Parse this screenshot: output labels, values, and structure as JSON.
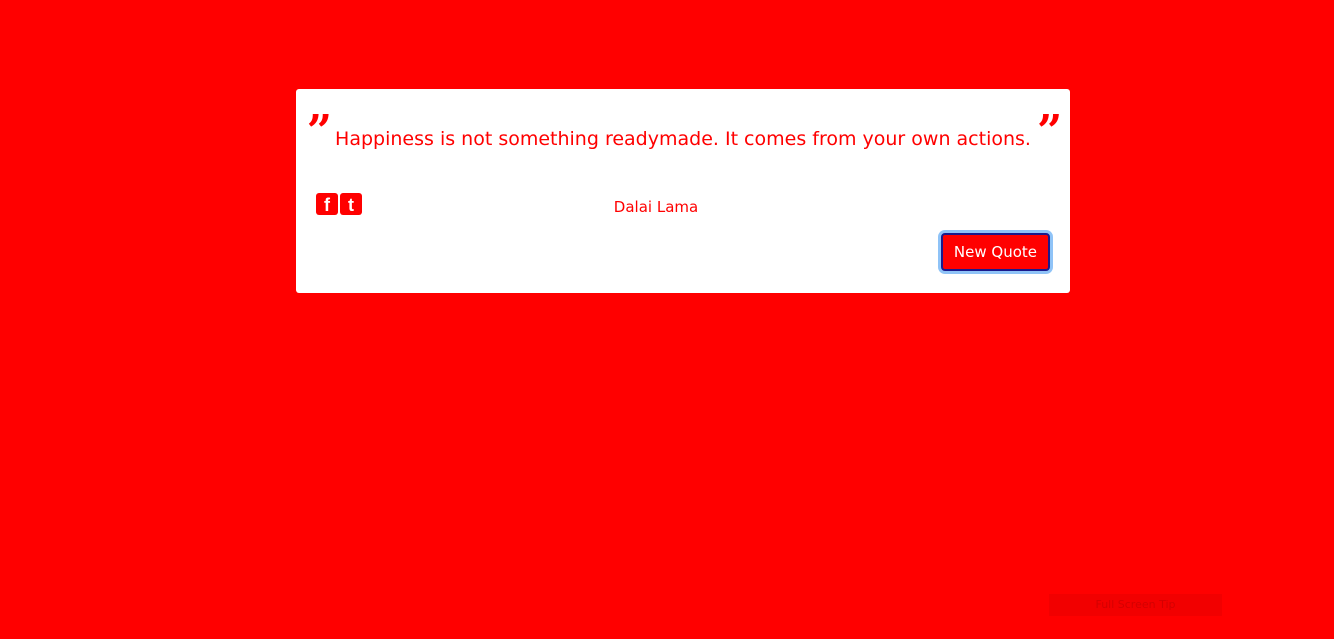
{
  "quote": {
    "open_mark": "”",
    "text": "Happiness is not something readymade. It comes from your own actions.",
    "close_mark": "”",
    "author": "Dalai Lama"
  },
  "share": {
    "facebook": {
      "icon": "facebook-icon",
      "glyph": "f"
    },
    "tumblr": {
      "icon": "tumblr-icon",
      "glyph": "t"
    }
  },
  "actions": {
    "new_quote_label": "New Quote"
  },
  "overlay": {
    "full_screen_tip": "Full Screen Tip"
  },
  "colors": {
    "background": "#ff0000",
    "card": "#ffffff",
    "accent": "#ff0000",
    "focus_ring": "#8fc3f7"
  }
}
